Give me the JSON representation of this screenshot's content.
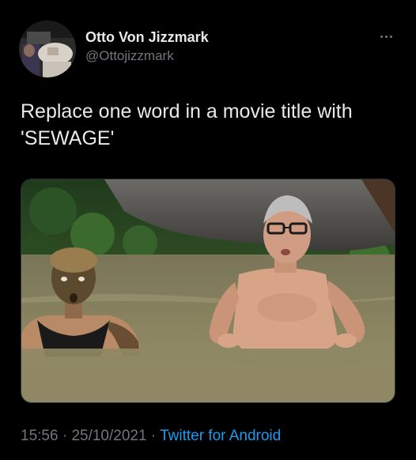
{
  "tweet": {
    "display_name": "Otto Von Jizzmark",
    "handle": "@Ottojizzmark",
    "text": "Replace one word in a movie title with\n'SEWAGE'",
    "time": "15:56",
    "separator": " · ",
    "date": "25/10/2021",
    "source": "Twitter for Android"
  },
  "icons": {
    "more": "more-horizontal-icon"
  },
  "colors": {
    "background": "#000000",
    "primary_text": "#e7e9ea",
    "secondary_text": "#71767b",
    "link": "#1d9bf0"
  }
}
